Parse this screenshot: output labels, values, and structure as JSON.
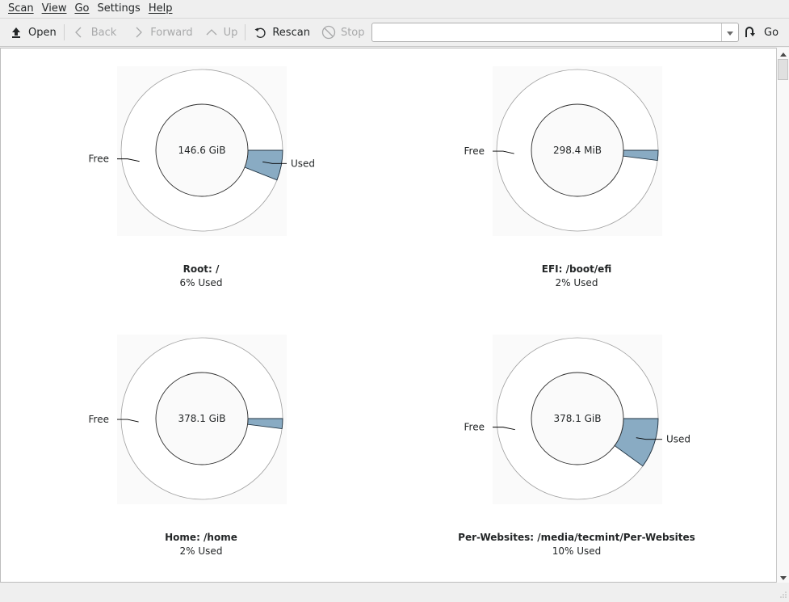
{
  "menubar": {
    "items": [
      {
        "label": "Scan",
        "accel": "S"
      },
      {
        "label": "View",
        "accel": "V"
      },
      {
        "label": "Go",
        "accel": "G"
      },
      {
        "label": "Settings",
        "accel": "t"
      },
      {
        "label": "Help",
        "accel": "H"
      }
    ]
  },
  "toolbar": {
    "open_label": "Open",
    "back_label": "Back",
    "forward_label": "Forward",
    "up_label": "Up",
    "rescan_label": "Rescan",
    "stop_label": "Stop",
    "location_value": "",
    "location_placeholder": "",
    "go_label": "Go"
  },
  "colors": {
    "used_fill": "#89abc3",
    "used_stroke": "#1e3140",
    "free_fill": "#ffffff",
    "panel_bg": "#fafafa"
  },
  "chart_data": [
    {
      "type": "pie",
      "title": "Root: /",
      "subtitle": "6% Used",
      "center_label": "146.6 GiB",
      "slices": [
        {
          "label": "Used",
          "percent": 6
        },
        {
          "label": "Free",
          "percent": 94
        }
      ],
      "show_used_label": true
    },
    {
      "type": "pie",
      "title": "EFI: /boot/efi",
      "subtitle": "2% Used",
      "center_label": "298.4 MiB",
      "slices": [
        {
          "label": "Used",
          "percent": 2
        },
        {
          "label": "Free",
          "percent": 98
        }
      ],
      "show_used_label": false
    },
    {
      "type": "pie",
      "title": "Home: /home",
      "subtitle": "2% Used",
      "center_label": "378.1 GiB",
      "slices": [
        {
          "label": "Used",
          "percent": 2
        },
        {
          "label": "Free",
          "percent": 98
        }
      ],
      "show_used_label": false
    },
    {
      "type": "pie",
      "title": "Per-Websites: /media/tecmint/Per-Websites",
      "subtitle": "10% Used",
      "center_label": "378.1 GiB",
      "slices": [
        {
          "label": "Used",
          "percent": 10
        },
        {
          "label": "Free",
          "percent": 90
        }
      ],
      "show_used_label": true
    }
  ]
}
